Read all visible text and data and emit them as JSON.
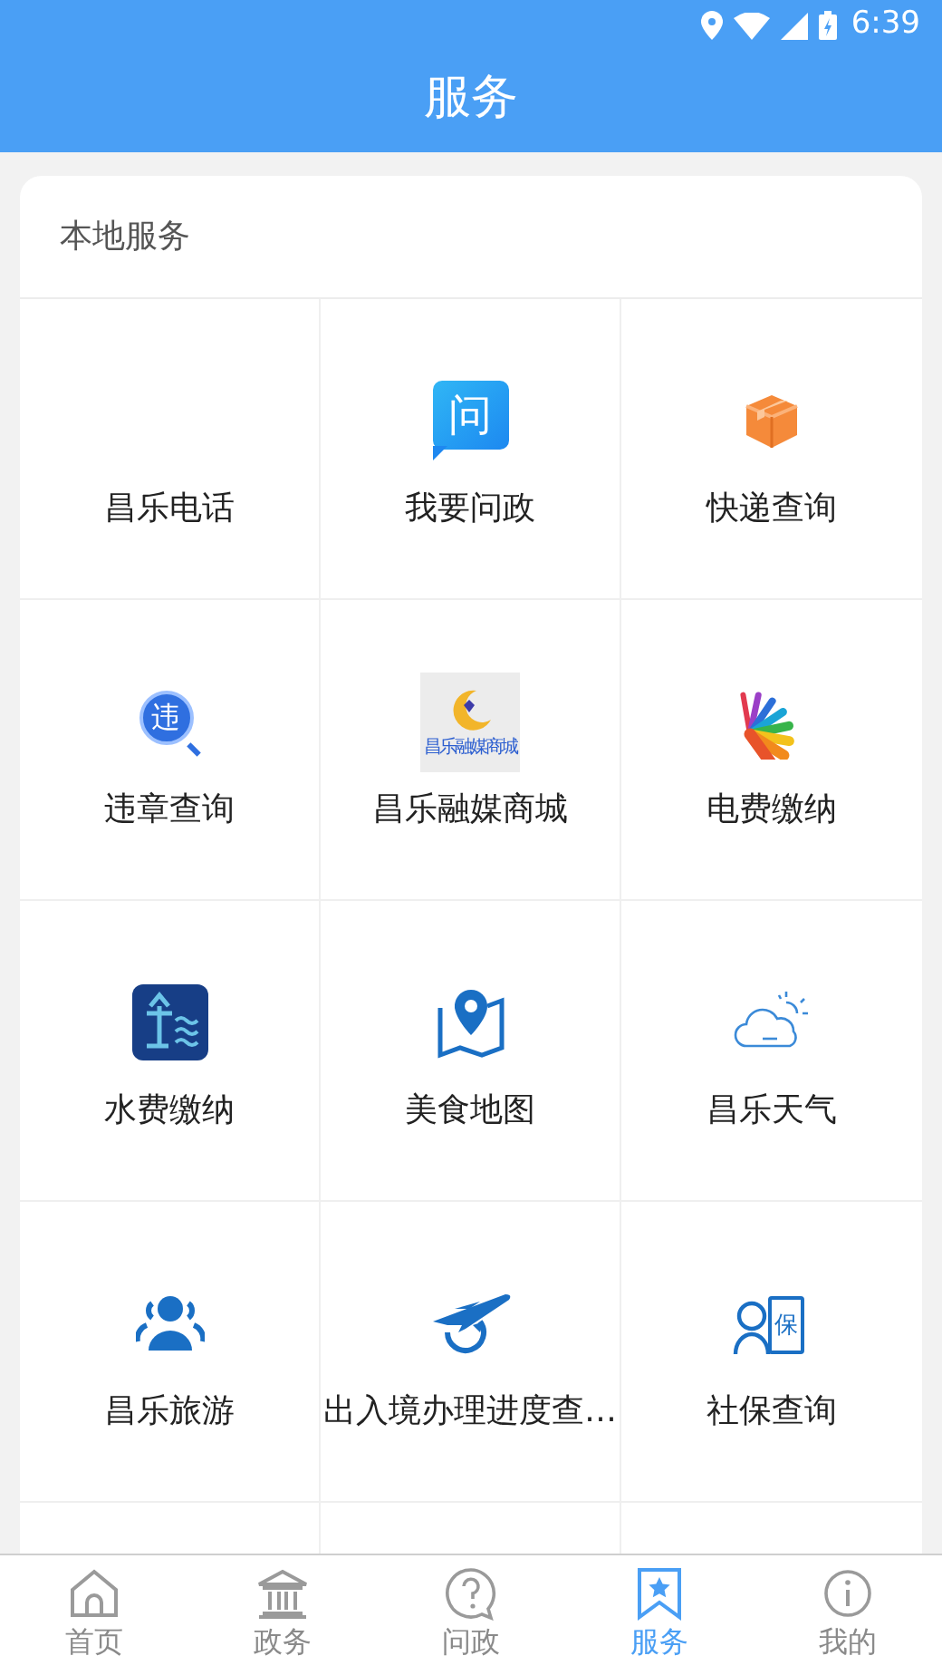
{
  "status_bar": {
    "time": "6:39"
  },
  "header": {
    "title": "服务"
  },
  "section": {
    "title": "本地服务"
  },
  "services": [
    {
      "label": "昌乐电话",
      "kind": "plain"
    },
    {
      "label": "我要问政",
      "kind": "ask",
      "icon_text": "问"
    },
    {
      "label": "快递查询",
      "kind": "box"
    },
    {
      "label": "违章查询",
      "kind": "search",
      "icon_text": "违"
    },
    {
      "label": "昌乐融媒商城",
      "kind": "shop",
      "icon_text": "昌乐融媒商城"
    },
    {
      "label": "电费缴纳",
      "kind": "fan"
    },
    {
      "label": "水费缴纳",
      "kind": "water"
    },
    {
      "label": "美食地图",
      "kind": "map"
    },
    {
      "label": "昌乐天气",
      "kind": "weather"
    },
    {
      "label": "昌乐旅游",
      "kind": "people"
    },
    {
      "label": "出入境办理进度查…",
      "kind": "plane"
    },
    {
      "label": "社保查询",
      "kind": "person",
      "icon_text": "保"
    }
  ],
  "tabs": [
    {
      "label": "首页",
      "kind": "home",
      "selected": false
    },
    {
      "label": "政务",
      "kind": "bank",
      "selected": false
    },
    {
      "label": "问政",
      "kind": "question",
      "selected": false
    },
    {
      "label": "服务",
      "kind": "bookmark",
      "selected": true
    },
    {
      "label": "我的",
      "kind": "info",
      "selected": false
    }
  ]
}
